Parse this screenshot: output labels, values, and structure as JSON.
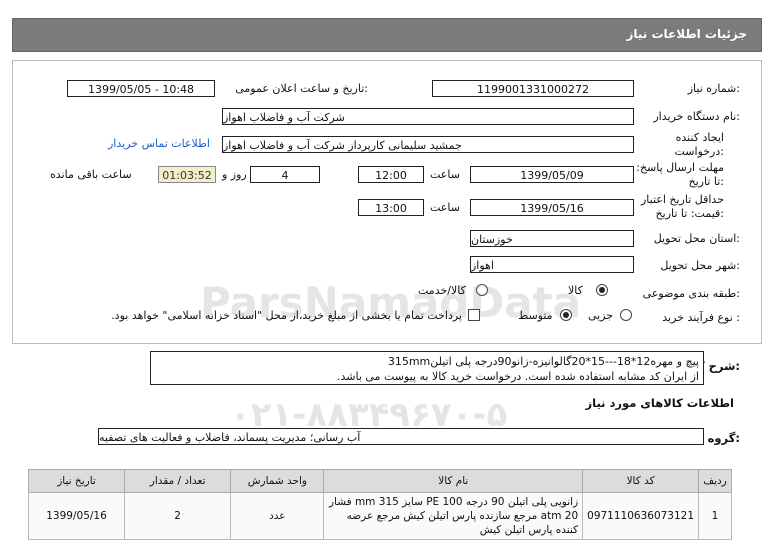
{
  "header": {
    "title": "جزئیات اطلاعات نیاز"
  },
  "fields": {
    "need_number_label": "شماره نیاز:",
    "need_number": "1199001331000272",
    "announce_label": "تاریخ و ساعت اعلان عمومی:",
    "announce_value": "1399/05/05 - 10:48",
    "buyer_org_label": "نام دستگاه خریدار:",
    "buyer_org": "شرکت آب و فاضلاب اهواز",
    "creator_label": "ایجاد کننده درخواست:",
    "creator": "جمشید سلیمانی کارپرداز شرکت آب و فاضلاب اهواز",
    "contact_link": "اطلاعات تماس خریدار",
    "deadline_label": "مهلت ارسال پاسخ: تا تاریخ:",
    "deadline_date": "1399/05/09",
    "time_label": "ساعت",
    "deadline_time": "12:00",
    "days": "4",
    "days_label": "روز و",
    "remaining": "01:03:52",
    "remaining_label": "ساعت باقی مانده",
    "validity_label": "حداقل تاریخ اعتبار قیمت: تا تاریخ:",
    "validity_date": "1399/05/16",
    "validity_time": "13:00",
    "province_label": "استان محل تحویل:",
    "province": "خوزستان",
    "city_label": "شهر محل تحویل:",
    "city": "اهواز",
    "category_label": "طبقه بندی موضوعی:",
    "category_options": [
      "کالا",
      "کالا/خدمت"
    ],
    "process_label": "نوع فرآیند خرید :",
    "process_options": [
      "جزیی",
      "متوسط"
    ],
    "payment_note": "پرداخت تمام یا بخشی از مبلغ خرید،از محل \"اسناد خزانه اسلامی\" خواهد بود."
  },
  "description": {
    "label": "شرح کلی نیاز:",
    "line1": "پیچ و مهره12*18---15*20گالوانیزه-زانو90درجه پلی اتیلن315mm",
    "line2": "از ایران کد مشابه استفاده شده است. درخواست خرید کالا به پیوست می باشد."
  },
  "goods": {
    "section_title": "اطلاعات کالاهای مورد نیاز",
    "group_label": "گروه کالا:",
    "group_value": "آب رسانی؛ مدیریت پسماند، فاضلاب و فعالیت های تصفیه"
  },
  "table": {
    "headers": [
      "ردیف",
      "کد کالا",
      "نام کالا",
      "واحد شمارش",
      "تعداد / مقدار",
      "تاریخ نیاز"
    ],
    "rows": [
      {
        "row": "1",
        "code": "0971110636073121",
        "name": "زانویی پلی اتیلن 90 درجه PE 100 سایز 315 mm فشار 20 atm مرجع سازنده پارس اتیلن کیش مرجع عرضه کننده پارس اتیلن کیش",
        "unit": "عدد",
        "qty": "2",
        "date": "1399/05/16"
      }
    ]
  },
  "watermark": {
    "text": "ParsNamadData",
    "phone": "۰۲۱-۸۸۳۴۹۶۷۰-۵"
  }
}
